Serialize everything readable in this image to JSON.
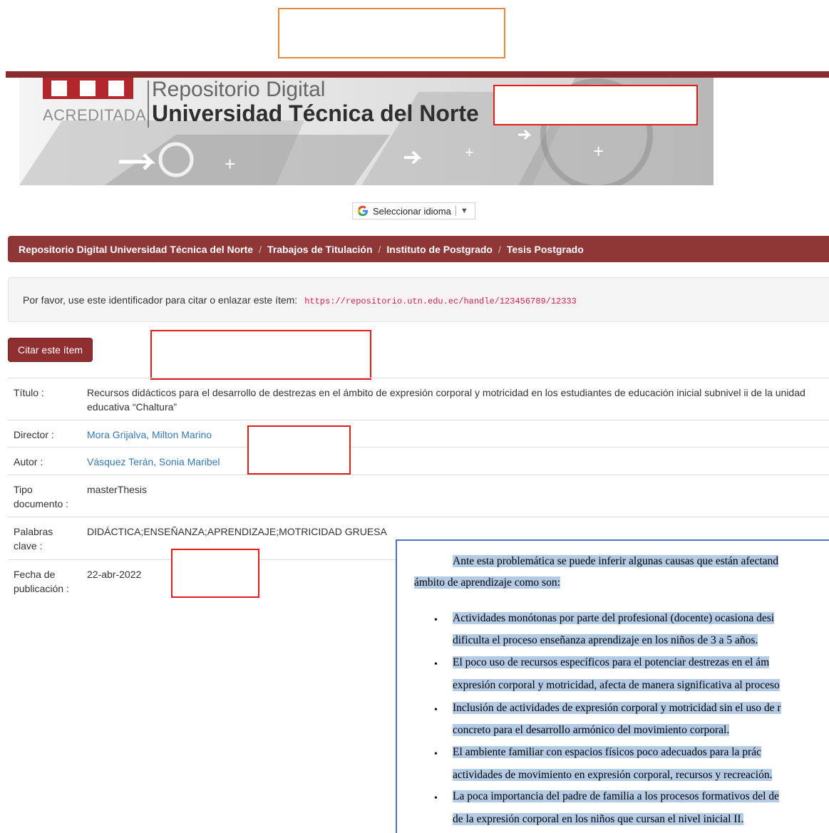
{
  "banner": {
    "acreditada": "ACREDITADA",
    "repo_title": "Repositorio Digital",
    "uni_title": "Universidad Técnica del Norte"
  },
  "translate": {
    "label": "Seleccionar idioma",
    "arrow": "▼"
  },
  "breadcrumb": {
    "items": [
      "Repositorio Digital Universidad Técnica del Norte",
      "Trabajos de Titulación",
      "Instituto de Postgrado",
      "Tesis Postgrado"
    ],
    "separator": "/"
  },
  "citation": {
    "text": "Por favor, use este identificador para citar o enlazar este ítem:",
    "url": "https://repositorio.utn.edu.ec/handle/123456789/12333"
  },
  "cite_button": "Citar este ítem",
  "metadata": {
    "titulo_label": "Título :",
    "titulo": "Recursos didácticos para el desarrollo de destrezas en el ámbito de expresión corporal y motricidad en los estudiantes de educación inicial subnivel ii de la unidad educativa “Chaltura”",
    "director_label": "Director :",
    "director": "Mora Grijalva, Milton Marino",
    "autor_label": "Autor :",
    "autor": "Vásquez Terán, Sonia Maribel",
    "tipo_label": "Tipo documento :",
    "tipo": "masterThesis",
    "palabras_label": "Palabras clave :",
    "palabras": "DIDÁCTICA;ENSEÑANZA;APRENDIZAJE;MOTRICIDAD GRUESA",
    "fecha_label": "Fecha de publicación :",
    "fecha": "22-abr-2022"
  },
  "excerpt": {
    "lines": [
      "Ante esta problemática se puede inferir algunas causas que están afectand",
      "ámbito de aprendizaje como son:",
      "Actividades monótonas por parte del profesional (docente) ocasiona desi",
      "dificulta el proceso enseñanza aprendizaje en los niños de 3 a 5 años.",
      "El poco uso de recursos específicos para el potenciar destrezas en el ám",
      "expresión corporal y motricidad, afecta de manera significativa al proceso",
      "Inclusión de actividades de expresión corporal y motricidad sin el uso de r",
      "concreto para el desarrollo armónico del movimiento corporal.",
      " El ambiente familiar con espacios físicos poco adecuados para la prác",
      "actividades de movimiento en expresión corporal, recursos y recreación.",
      "La poca importancia del padre de familia a los procesos formativos del de",
      "de la expresión corporal en los niños que cursan el nivel inicial II."
    ],
    "bullet": "•"
  },
  "colors": {
    "brand": "#8f3637",
    "highlight": "#b4cbe6",
    "link": "#337ab7"
  }
}
